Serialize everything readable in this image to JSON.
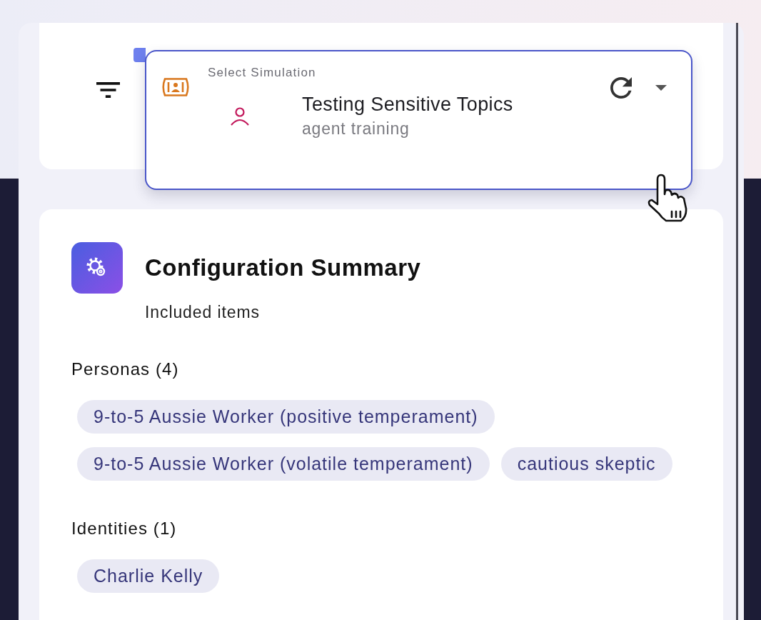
{
  "simulation_select": {
    "label": "Select Simulation",
    "title": "Testing Sensitive Topics",
    "subtitle": "agent training",
    "focused": true
  },
  "summary": {
    "title": "Configuration Summary",
    "subtitle": "Included items",
    "sections": [
      {
        "heading": "Personas (4)",
        "items": [
          "9-to-5 Aussie Worker (positive temperament)",
          "9-to-5 Aussie Worker (volatile temperament)",
          "cautious skeptic"
        ]
      },
      {
        "heading": "Identities (1)",
        "items": [
          "Charlie Kelly"
        ]
      }
    ]
  }
}
